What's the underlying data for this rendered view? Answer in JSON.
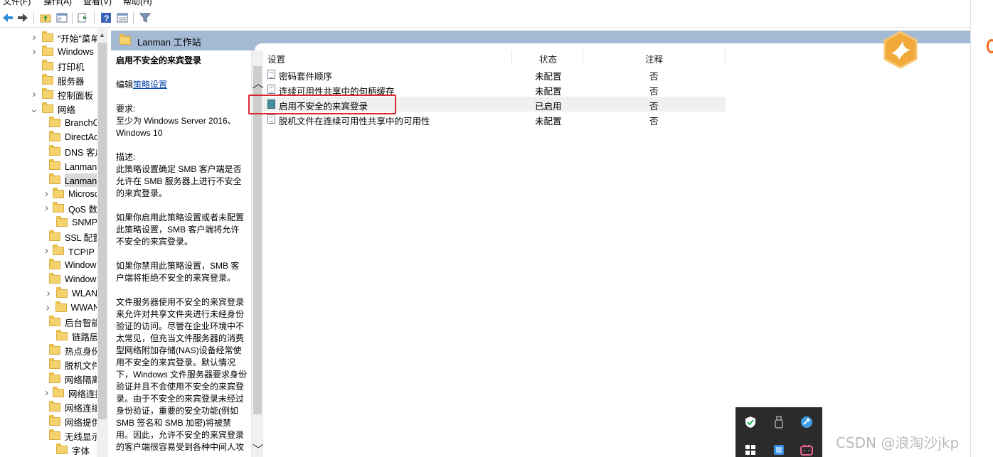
{
  "menu": [
    "文件(F)",
    "操作(A)",
    "查看(V)",
    "帮助(H)"
  ],
  "toolbar": {
    "icons": [
      "back-icon",
      "forward-icon",
      "up-folder-icon",
      "show-hide-tree-icon",
      "export-list-icon",
      "help-icon",
      "view-icon",
      "filter-icon"
    ]
  },
  "tree": {
    "items": [
      {
        "label": "\"开始\"菜单",
        "expandable": true,
        "indent": 1
      },
      {
        "label": "Windows",
        "expandable": true,
        "indent": 1
      },
      {
        "label": "打印机",
        "expandable": false,
        "indent": 1
      },
      {
        "label": "服务器",
        "expandable": false,
        "indent": 1
      },
      {
        "label": "控制面板",
        "expandable": true,
        "indent": 1
      },
      {
        "label": "网络",
        "expandable": true,
        "expanded": true,
        "indent": 1
      },
      {
        "label": "BranchCache",
        "expandable": false,
        "indent": 2
      },
      {
        "label": "DirectAccess",
        "expandable": false,
        "indent": 2
      },
      {
        "label": "DNS 客户端",
        "expandable": false,
        "indent": 2
      },
      {
        "label": "Lanman 服务器",
        "expandable": false,
        "indent": 2
      },
      {
        "label": "Lanman 工作站",
        "expandable": false,
        "indent": 2,
        "selected": true
      },
      {
        "label": "Microsoft",
        "expandable": true,
        "indent": 2
      },
      {
        "label": "QoS 数据包",
        "expandable": true,
        "indent": 2
      },
      {
        "label": "SNMP",
        "expandable": false,
        "indent": 2
      },
      {
        "label": "SSL 配置",
        "expandable": false,
        "indent": 2
      },
      {
        "label": "TCPIP 设置",
        "expandable": true,
        "indent": 2
      },
      {
        "label": "Windows",
        "expandable": false,
        "indent": 2
      },
      {
        "label": "Windows",
        "expandable": false,
        "indent": 2
      },
      {
        "label": "WLAN",
        "expandable": true,
        "indent": 2
      },
      {
        "label": "WWAN",
        "expandable": true,
        "indent": 2
      },
      {
        "label": "后台智能",
        "expandable": false,
        "indent": 2
      },
      {
        "label": "链路层",
        "expandable": false,
        "indent": 2
      },
      {
        "label": "热点身份",
        "expandable": false,
        "indent": 2
      },
      {
        "label": "脱机文件",
        "expandable": false,
        "indent": 2
      },
      {
        "label": "网络隔离",
        "expandable": false,
        "indent": 2
      },
      {
        "label": "网络连接",
        "expandable": true,
        "indent": 2
      },
      {
        "label": "网络连接",
        "expandable": false,
        "indent": 2
      },
      {
        "label": "网络提供",
        "expandable": false,
        "indent": 2
      },
      {
        "label": "无线显示",
        "expandable": false,
        "indent": 2
      },
      {
        "label": "字体",
        "expandable": false,
        "indent": 2
      }
    ]
  },
  "header": {
    "title": "Lanman 工作站"
  },
  "description": {
    "title": "启用不安全的来宾登录",
    "edit_prefix": "编辑",
    "edit_link": "策略设置",
    "requirements_label": "要求:",
    "requirements": "至少为 Windows Server 2016、Windows 10",
    "desc_label": "描述:",
    "para1": "此策略设置确定 SMB 客户端是否允许在 SMB 服务器上进行不安全的来宾登录。",
    "para2": "如果你启用此策略设置或者未配置此策略设置，SMB 客户端将允许不安全的来宾登录。",
    "para3": "如果你禁用此策略设置，SMB 客户端将拒绝不安全的来宾登录。",
    "para4": "文件服务器使用不安全的来宾登录来允许对共享文件夹进行未经身份验证的访问。尽管在企业环境中不太常见，但充当文件服务器的消费型网络附加存储(NAS)设备经常使用不安全的来宾登录。默认情况下，Windows 文件服务器要求身份验证并且不会使用不安全的来宾登录。由于不安全的来宾登录未经过身份验证，重要的安全功能(例如 SMB 签名和 SMB 加密)将被禁用。因此，允许不安全的来宾登录的客户端很容易受到各种中间人攻"
  },
  "list": {
    "columns": {
      "setting": "设置",
      "state": "状态",
      "comment": "注释"
    },
    "rows": [
      {
        "name": "密码套件顺序",
        "state": "未配置",
        "comment": "否",
        "enabled": false
      },
      {
        "name": "连续可用性共享中的句柄缓存",
        "state": "未配置",
        "comment": "否",
        "enabled": false
      },
      {
        "name": "启用不安全的来宾登录",
        "state": "已启用",
        "comment": "否",
        "enabled": true,
        "highlighted": true
      },
      {
        "name": "脱机文件在连续可用性共享中的可用性",
        "state": "未配置",
        "comment": "否",
        "enabled": false
      }
    ]
  },
  "tray": {
    "icons": [
      "defender-shield-icon",
      "usb-eject-icon",
      "network-tool-icon",
      "start-grid-icon",
      "app-icon",
      "bilibili-icon"
    ]
  },
  "watermark": "CSDN @浪淘沙jkp",
  "colors": {
    "header_band": "#a4b9d4",
    "highlight_box": "#d9272e",
    "link": "#0645ad"
  }
}
